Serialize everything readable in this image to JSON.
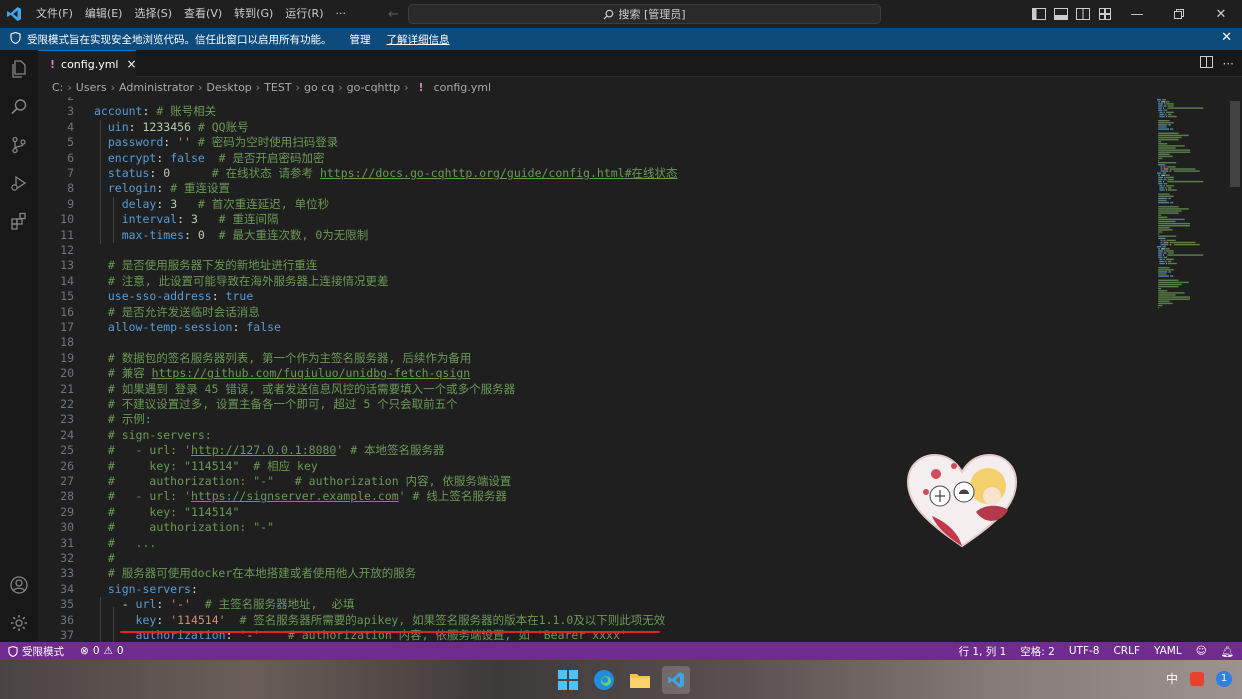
{
  "titlebar": {
    "menu": [
      "文件(F)",
      "编辑(E)",
      "选择(S)",
      "查看(V)",
      "转到(G)",
      "运行(R)",
      "···"
    ],
    "search_placeholder": "搜索 [管理员]"
  },
  "banner": {
    "message": "受限模式旨在实现安全地浏览代码。信任此窗口以启用所有功能。",
    "manage_link": "管理",
    "learn_more_link": "了解详细信息"
  },
  "tab": {
    "name": "config.yml",
    "close": "×"
  },
  "breadcrumb": [
    "C:",
    "Users",
    "Administrator",
    "Desktop",
    "TEST",
    "go cq",
    "go-cqhttp",
    "config.yml"
  ],
  "editor": {
    "lines": [
      {
        "n": "2",
        "t": ""
      },
      {
        "n": "3",
        "t": ""
      },
      {
        "n": "4",
        "t": ""
      },
      {
        "n": "5",
        "t": ""
      },
      {
        "n": "6",
        "t": ""
      },
      {
        "n": "7",
        "t": ""
      },
      {
        "n": "8",
        "t": ""
      },
      {
        "n": "9",
        "t": ""
      },
      {
        "n": "10",
        "t": ""
      },
      {
        "n": "11",
        "t": ""
      },
      {
        "n": "12",
        "t": ""
      },
      {
        "n": "13",
        "t": ""
      },
      {
        "n": "14",
        "t": ""
      },
      {
        "n": "15",
        "t": ""
      },
      {
        "n": "16",
        "t": ""
      },
      {
        "n": "17",
        "t": ""
      },
      {
        "n": "18",
        "t": ""
      },
      {
        "n": "19",
        "t": ""
      },
      {
        "n": "20",
        "t": ""
      },
      {
        "n": "21",
        "t": ""
      },
      {
        "n": "22",
        "t": ""
      },
      {
        "n": "23",
        "t": ""
      },
      {
        "n": "24",
        "t": ""
      },
      {
        "n": "25",
        "t": ""
      },
      {
        "n": "26",
        "t": ""
      },
      {
        "n": "27",
        "t": ""
      },
      {
        "n": "28",
        "t": ""
      },
      {
        "n": "29",
        "t": ""
      },
      {
        "n": "30",
        "t": ""
      },
      {
        "n": "31",
        "t": ""
      },
      {
        "n": "32",
        "t": ""
      },
      {
        "n": "33",
        "t": ""
      },
      {
        "n": "34",
        "t": ""
      },
      {
        "n": "35",
        "t": ""
      },
      {
        "n": "36",
        "t": ""
      },
      {
        "n": "37",
        "t": ""
      }
    ],
    "tokens": {
      "l3": [
        [
          "k",
          "account"
        ],
        [
          "p",
          ": "
        ],
        [
          "c",
          "# 账号相关"
        ]
      ],
      "l4": [
        [
          "p",
          "  "
        ],
        [
          "k",
          "uin"
        ],
        [
          "p",
          ": "
        ],
        [
          "n",
          "1233456"
        ],
        [
          "p",
          " "
        ],
        [
          "c",
          "# QQ账号"
        ]
      ],
      "l5": [
        [
          "p",
          "  "
        ],
        [
          "k",
          "password"
        ],
        [
          "p",
          ": "
        ],
        [
          "s",
          "''"
        ],
        [
          "p",
          " "
        ],
        [
          "c",
          "# 密码为空时使用扫码登录"
        ]
      ],
      "l6": [
        [
          "p",
          "  "
        ],
        [
          "k",
          "encrypt"
        ],
        [
          "p",
          ": "
        ],
        [
          "b",
          "false"
        ],
        [
          "p",
          "  "
        ],
        [
          "c",
          "# 是否开启密码加密"
        ]
      ],
      "l7": [
        [
          "p",
          "  "
        ],
        [
          "k",
          "status"
        ],
        [
          "p",
          ": "
        ],
        [
          "n",
          "0"
        ],
        [
          "p",
          "      "
        ],
        [
          "c",
          "# 在线状态 请参考 "
        ],
        [
          "u",
          "https://docs.go-cqhttp.org/guide/config.html#在线状态"
        ]
      ],
      "l8": [
        [
          "p",
          "  "
        ],
        [
          "k",
          "relogin"
        ],
        [
          "p",
          ": "
        ],
        [
          "c",
          "# 重连设置"
        ]
      ],
      "l9": [
        [
          "p",
          "    "
        ],
        [
          "k",
          "delay"
        ],
        [
          "p",
          ": "
        ],
        [
          "n",
          "3"
        ],
        [
          "p",
          "   "
        ],
        [
          "c",
          "# 首次重连延迟, 单位秒"
        ]
      ],
      "l10": [
        [
          "p",
          "    "
        ],
        [
          "k",
          "interval"
        ],
        [
          "p",
          ": "
        ],
        [
          "n",
          "3"
        ],
        [
          "p",
          "   "
        ],
        [
          "c",
          "# 重连间隔"
        ]
      ],
      "l11": [
        [
          "p",
          "    "
        ],
        [
          "k",
          "max-times"
        ],
        [
          "p",
          ": "
        ],
        [
          "n",
          "0"
        ],
        [
          "p",
          "  "
        ],
        [
          "c",
          "# 最大重连次数, 0为无限制"
        ]
      ],
      "l12": [],
      "l13": [
        [
          "p",
          "  "
        ],
        [
          "c",
          "# 是否使用服务器下发的新地址进行重连"
        ]
      ],
      "l14": [
        [
          "p",
          "  "
        ],
        [
          "c",
          "# 注意, 此设置可能导致在海外服务器上连接情况更差"
        ]
      ],
      "l15": [
        [
          "p",
          "  "
        ],
        [
          "k",
          "use-sso-address"
        ],
        [
          "p",
          ": "
        ],
        [
          "b",
          "true"
        ]
      ],
      "l16": [
        [
          "p",
          "  "
        ],
        [
          "c",
          "# 是否允许发送临时会话消息"
        ]
      ],
      "l17": [
        [
          "p",
          "  "
        ],
        [
          "k",
          "allow-temp-session"
        ],
        [
          "p",
          ": "
        ],
        [
          "b",
          "false"
        ]
      ],
      "l18": [],
      "l19": [
        [
          "p",
          "  "
        ],
        [
          "c",
          "# 数据包的签名服务器列表, 第一个作为主签名服务器, 后续作为备用"
        ]
      ],
      "l20": [
        [
          "p",
          "  "
        ],
        [
          "c",
          "# 兼容 "
        ],
        [
          "u",
          "https://github.com/fuqiuluo/unidbg-fetch-qsign"
        ]
      ],
      "l21": [
        [
          "p",
          "  "
        ],
        [
          "c",
          "# 如果遇到 登录 45 错误, 或者发送信息风控的话需要填入一个或多个服务器"
        ]
      ],
      "l22": [
        [
          "p",
          "  "
        ],
        [
          "c",
          "# 不建议设置过多, 设置主备各一个即可, 超过 5 个只会取前五个"
        ]
      ],
      "l23": [
        [
          "p",
          "  "
        ],
        [
          "c",
          "# 示例:"
        ]
      ],
      "l24": [
        [
          "p",
          "  "
        ],
        [
          "c",
          "# sign-servers:"
        ]
      ],
      "l25": [
        [
          "p",
          "  "
        ],
        [
          "c",
          "#   - url: '"
        ],
        [
          "u",
          "http://127.0.0.1:8080"
        ],
        [
          "c",
          "' # 本地签名服务器"
        ]
      ],
      "l26": [
        [
          "p",
          "  "
        ],
        [
          "c",
          "#     key: \"114514\"  # 相应 key"
        ]
      ],
      "l27": [
        [
          "p",
          "  "
        ],
        [
          "c",
          "#     authorization: \"-\"   # authorization 内容, 依服务端设置"
        ]
      ],
      "l28": [
        [
          "p",
          "  "
        ],
        [
          "c",
          "#   - url: '"
        ],
        [
          "u",
          "https://signserver.example.com"
        ],
        [
          "c",
          "' # 线上签名服务器"
        ]
      ],
      "l29": [
        [
          "p",
          "  "
        ],
        [
          "c",
          "#     key: \"114514\""
        ]
      ],
      "l30": [
        [
          "p",
          "  "
        ],
        [
          "c",
          "#     authorization: \"-\""
        ]
      ],
      "l31": [
        [
          "p",
          "  "
        ],
        [
          "c",
          "#   ..."
        ]
      ],
      "l32": [
        [
          "p",
          "  "
        ],
        [
          "c",
          "#"
        ]
      ],
      "l33": [
        [
          "p",
          "  "
        ],
        [
          "c",
          "# 服务器可使用docker在本地搭建或者使用他人开放的服务"
        ]
      ],
      "l34": [
        [
          "p",
          "  "
        ],
        [
          "k",
          "sign-servers"
        ],
        [
          "p",
          ":"
        ]
      ],
      "l35": [
        [
          "p",
          "    - "
        ],
        [
          "k",
          "url"
        ],
        [
          "p",
          ": "
        ],
        [
          "s",
          "'-'"
        ],
        [
          "p",
          "  "
        ],
        [
          "c",
          "# 主签名服务器地址,  必填"
        ]
      ],
      "l36": [
        [
          "p",
          "      "
        ],
        [
          "k",
          "key"
        ],
        [
          "p",
          ": "
        ],
        [
          "s",
          "'114514'"
        ],
        [
          "p",
          "  "
        ],
        [
          "c",
          "# 签名服务器所需要的apikey, 如果签名服务器的版本在1.1.0及以下则此项无效"
        ]
      ],
      "l37": [
        [
          "p",
          "      "
        ],
        [
          "k",
          "authorization"
        ],
        [
          "p",
          ": "
        ],
        [
          "s",
          "'-'"
        ],
        [
          "p",
          "    "
        ],
        [
          "c",
          "# authorization 内容, 依服务端设置, 如 'Bearer xxxx'"
        ]
      ]
    }
  },
  "statusbar": {
    "restricted": "受限模式",
    "errors": "0",
    "warnings": "0",
    "position": "行 1, 列 1",
    "spaces": "空格: 2",
    "encoding": "UTF-8",
    "eol": "CRLF",
    "language": "YAML"
  },
  "taskbar": {
    "ime": "中",
    "notification_count": "1"
  },
  "colors": {
    "accent": "#0078d4",
    "statusbar": "#6f2b8f",
    "banner": "#0e4b7d",
    "annotation": "#e02424"
  }
}
